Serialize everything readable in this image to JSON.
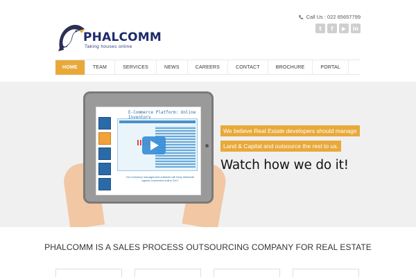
{
  "header": {
    "logo": {
      "name": "PHALCOMM",
      "tagline": "Taking houses online"
    },
    "contact": {
      "call_label": "Call Us : 022 65657799",
      "icon": "phone-icon"
    },
    "social": [
      {
        "name": "twitter-icon",
        "glyph": "t"
      },
      {
        "name": "facebook-icon",
        "glyph": "f"
      },
      {
        "name": "youtube-icon",
        "glyph": "▶"
      },
      {
        "name": "linkedin-icon",
        "glyph": "in"
      }
    ]
  },
  "nav": {
    "items": [
      {
        "label": "HOME",
        "active": true
      },
      {
        "label": "TEAM"
      },
      {
        "label": "SERVICES"
      },
      {
        "label": "NEWS"
      },
      {
        "label": "CAREERS"
      },
      {
        "label": "CONTACT"
      },
      {
        "label": "BROCHURE"
      },
      {
        "label": "PORTAL"
      }
    ]
  },
  "hero": {
    "screen_title": "E-Commerce Platform: Online Inventory",
    "screen_footer": "Our inventory management software will keep distribute agents connected online 24x7",
    "tagline_1": "We believe Real Estate developers should manage",
    "tagline_2": "Land & Capital and outsource the rest to us.",
    "cta": "Watch how we do it!"
  },
  "intro": {
    "heading": "PHALCOMM IS A SALES PROCESS OUTSOURCING COMPANY FOR REAL ESTATE"
  },
  "colors": {
    "accent": "#e8a93a",
    "logo": "#1d2a6b",
    "hero_bg": "#f0f0f0"
  }
}
